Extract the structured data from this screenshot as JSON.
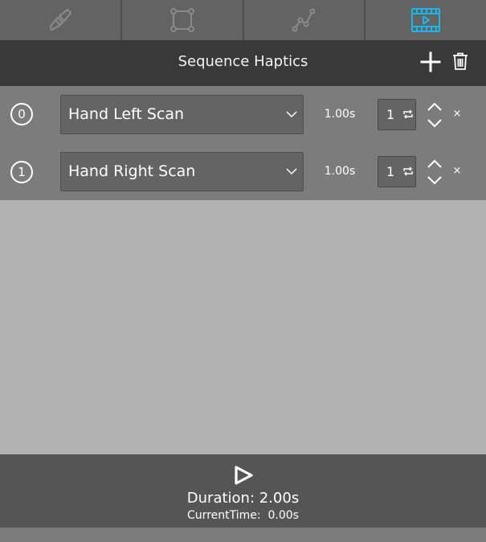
{
  "tabs": [
    {
      "name": "brush",
      "icon": "paintbrush-icon",
      "active": false
    },
    {
      "name": "shape",
      "icon": "bounding-box-icon",
      "active": false
    },
    {
      "name": "path",
      "icon": "node-path-icon",
      "active": false
    },
    {
      "name": "sequence",
      "icon": "film-play-icon",
      "active": true
    }
  ],
  "colors": {
    "accent": "#1db4e8",
    "tab_icon": "#8a8a8a",
    "header_bg": "#393939",
    "row_bg": "#7c7c7c",
    "empty_bg": "#b2b2b2",
    "footer_bg": "#555555"
  },
  "header": {
    "title": "Sequence Haptics",
    "add_icon": "plus-icon",
    "delete_icon": "trash-icon"
  },
  "rows": [
    {
      "index": "0",
      "haptic": "Hand Left Scan",
      "duration": "1.00s",
      "loops": "1"
    },
    {
      "index": "1",
      "haptic": "Hand Right Scan",
      "duration": "1.00s",
      "loops": "1"
    }
  ],
  "row_icons": {
    "dropdown": "chevron-down-icon",
    "loop": "loop-icon",
    "reorder": "up-down-chevron-icon",
    "remove": "close-icon",
    "remove_glyph": "×"
  },
  "footer": {
    "play_icon": "play-icon",
    "duration_text": "Duration: 2.00s",
    "current_time_text": "CurrentTime:  0.00s"
  }
}
